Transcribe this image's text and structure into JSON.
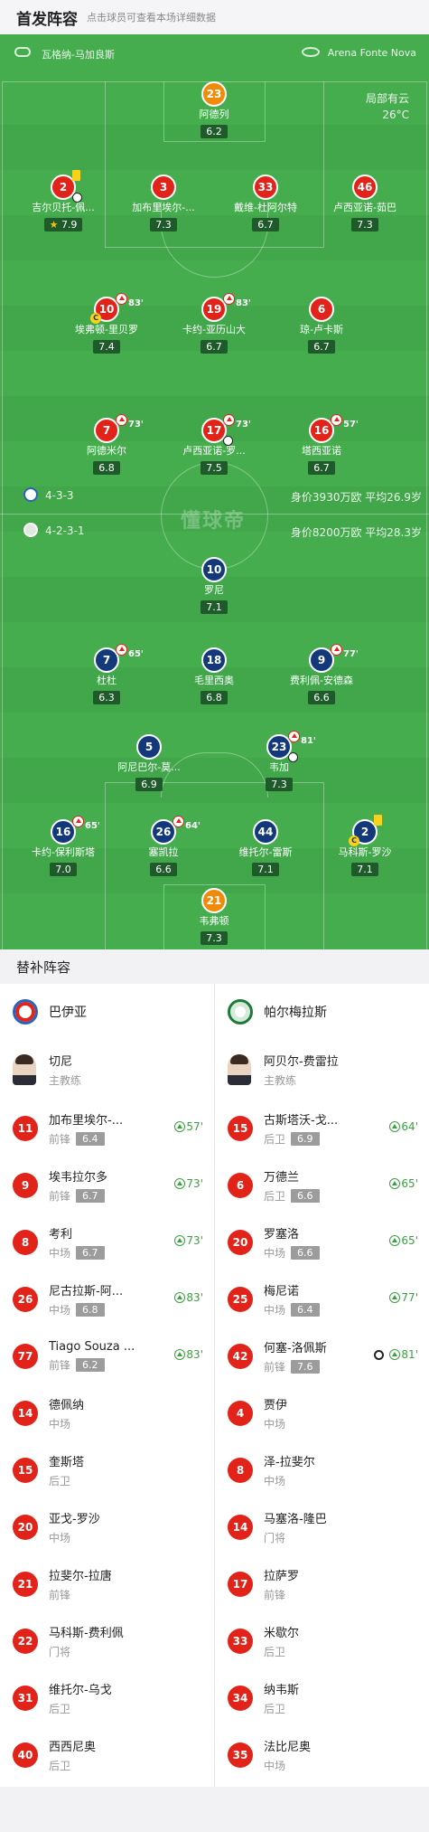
{
  "header": {
    "title": "首发阵容",
    "subtitle": "点击球员可查看本场详细数据"
  },
  "field": {
    "stadium_left": "瓦格纳-马加良斯",
    "stadium_right": "Arena Fonte Nova",
    "weather": "局部有云",
    "temperature": "26°C",
    "watermark": "懂球帝",
    "home_formation": "4-3-3",
    "home_value": "身价3930万欧  平均26.9岁",
    "away_formation": "4-2-3-1",
    "away_value": "身价8200万欧  平均28.3岁",
    "home_players": [
      {
        "num": "23",
        "name": "阿德列",
        "rating": "6.2"
      },
      {
        "num": "2",
        "name": "吉尔贝托-佩...",
        "rating": "7.9"
      },
      {
        "num": "3",
        "name": "加布里埃尔-...",
        "rating": "7.3"
      },
      {
        "num": "33",
        "name": "戴维-杜阿尔特",
        "rating": "6.7"
      },
      {
        "num": "46",
        "name": "卢西亚诺-茹巴",
        "rating": "7.3"
      },
      {
        "num": "10",
        "name": "埃弗顿-里贝罗",
        "rating": "7.4",
        "sub": "83'"
      },
      {
        "num": "19",
        "name": "卡约-亚历山大",
        "rating": "6.7",
        "sub": "83'"
      },
      {
        "num": "6",
        "name": "琼-卢卡斯",
        "rating": "6.7"
      },
      {
        "num": "7",
        "name": "阿德米尔",
        "rating": "6.8",
        "sub": "73'"
      },
      {
        "num": "17",
        "name": "卢西亚诺-罗...",
        "rating": "7.5",
        "sub": "73'"
      },
      {
        "num": "16",
        "name": "塔西亚诺",
        "rating": "6.7",
        "sub": "57'"
      }
    ],
    "away_players": [
      {
        "num": "10",
        "name": "罗尼",
        "rating": "7.1"
      },
      {
        "num": "7",
        "name": "杜杜",
        "rating": "6.3",
        "sub": "65'"
      },
      {
        "num": "18",
        "name": "毛里西奥",
        "rating": "6.8"
      },
      {
        "num": "9",
        "name": "费利佩-安德森",
        "rating": "6.6",
        "sub": "77'"
      },
      {
        "num": "5",
        "name": "阿尼巴尔-莫...",
        "rating": "6.9"
      },
      {
        "num": "23",
        "name": "韦加",
        "rating": "7.3",
        "sub": "81'"
      },
      {
        "num": "16",
        "name": "卡约-保利斯塔",
        "rating": "7.0",
        "sub": "65'"
      },
      {
        "num": "26",
        "name": "塞凯拉",
        "rating": "6.6",
        "sub": "64'"
      },
      {
        "num": "44",
        "name": "维托尔-雷斯",
        "rating": "7.1"
      },
      {
        "num": "2",
        "name": "马科斯-罗沙",
        "rating": "7.1"
      },
      {
        "num": "21",
        "name": "韦弗顿",
        "rating": "7.3"
      }
    ]
  },
  "subs": {
    "title": "替补阵容",
    "home": {
      "team": "巴伊亚",
      "coach": {
        "name": "切尼",
        "role": "主教练"
      },
      "players": [
        {
          "num": "11",
          "name": "加布里埃尔-...",
          "pos": "前锋",
          "rating": "6.4",
          "min": "57'"
        },
        {
          "num": "9",
          "name": "埃韦拉尔多",
          "pos": "前锋",
          "rating": "6.7",
          "min": "73'"
        },
        {
          "num": "8",
          "name": "考利",
          "pos": "中场",
          "rating": "6.7",
          "min": "73'"
        },
        {
          "num": "26",
          "name": "尼古拉斯-阿...",
          "pos": "中场",
          "rating": "6.8",
          "min": "83'"
        },
        {
          "num": "77",
          "name": "Tiago Souza ...",
          "pos": "前锋",
          "rating": "6.2",
          "min": "83'"
        },
        {
          "num": "14",
          "name": "德佩纳",
          "pos": "中场"
        },
        {
          "num": "15",
          "name": "奎斯塔",
          "pos": "后卫"
        },
        {
          "num": "20",
          "name": "亚戈-罗沙",
          "pos": "中场"
        },
        {
          "num": "21",
          "name": "拉斐尔-拉唐",
          "pos": "前锋"
        },
        {
          "num": "22",
          "name": "马科斯-费利佩",
          "pos": "门将"
        },
        {
          "num": "31",
          "name": "维托尔-乌戈",
          "pos": "后卫"
        },
        {
          "num": "40",
          "name": "西西尼奥",
          "pos": "后卫"
        }
      ]
    },
    "away": {
      "team": "帕尔梅拉斯",
      "coach": {
        "name": "阿贝尔-费雷拉",
        "role": "主教练"
      },
      "players": [
        {
          "num": "15",
          "name": "古斯塔沃-戈...",
          "pos": "后卫",
          "rating": "6.9",
          "min": "64'"
        },
        {
          "num": "6",
          "name": "万德兰",
          "pos": "后卫",
          "rating": "6.6",
          "min": "65'"
        },
        {
          "num": "20",
          "name": "罗塞洛",
          "pos": "中场",
          "rating": "6.6",
          "min": "65'"
        },
        {
          "num": "25",
          "name": "梅尼诺",
          "pos": "中场",
          "rating": "6.4",
          "min": "77'"
        },
        {
          "num": "42",
          "name": "何塞-洛佩斯",
          "pos": "前锋",
          "rating": "7.6",
          "min": "81'",
          "goal": true
        },
        {
          "num": "4",
          "name": "贾伊",
          "pos": "中场"
        },
        {
          "num": "8",
          "name": "泽-拉斐尔",
          "pos": "中场"
        },
        {
          "num": "14",
          "name": "马塞洛-隆巴",
          "pos": "门将"
        },
        {
          "num": "17",
          "name": "拉萨罗",
          "pos": "前锋"
        },
        {
          "num": "33",
          "name": "米歇尔",
          "pos": "后卫"
        },
        {
          "num": "34",
          "name": "纳韦斯",
          "pos": "后卫"
        },
        {
          "num": "35",
          "name": "法比尼奥",
          "pos": "中场"
        }
      ]
    }
  },
  "colors": {
    "home": "#e2231a",
    "away": "#13397a",
    "field": "#46ad4f",
    "keeper_home": "#f08a0a",
    "sub_green": "#3aa040"
  }
}
